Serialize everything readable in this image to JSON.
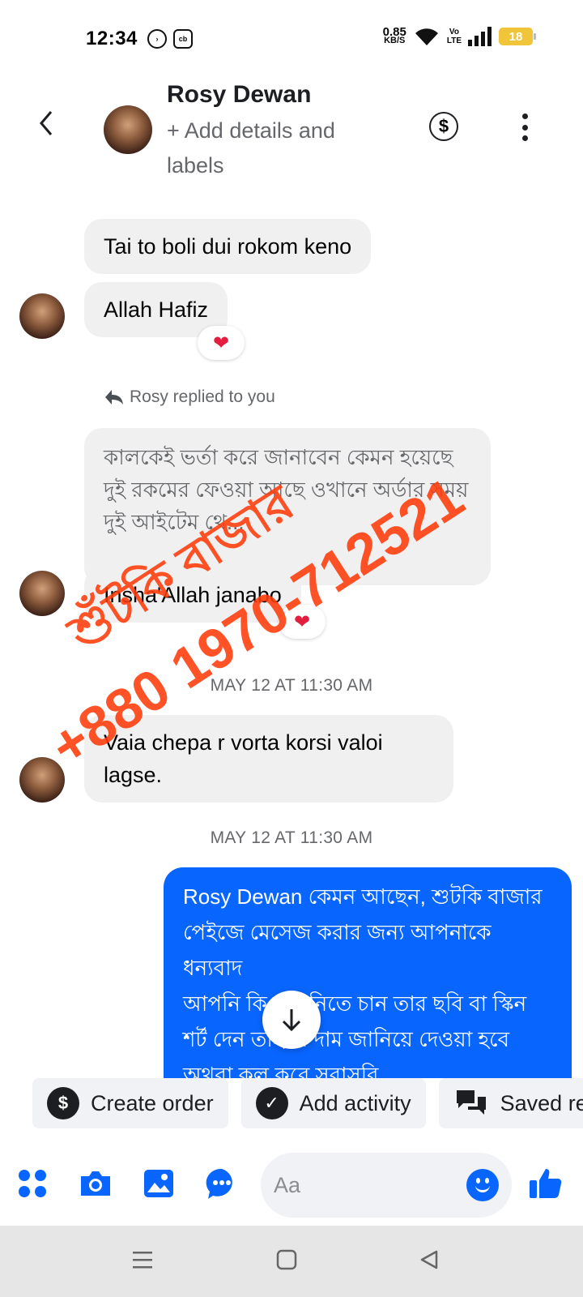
{
  "status_bar": {
    "time": "12:34",
    "speed_value": "0.85",
    "speed_unit": "KB/S",
    "volte_top": "Vo",
    "volte_bottom": "LTE",
    "battery": "18"
  },
  "header": {
    "contact_name": "Rosy Dewan",
    "add_details": "+ Add details and labels",
    "back_icon": "chevron-left-icon",
    "pay_icon": "dollar-circle-icon",
    "more_icon": "vertical-dots-icon"
  },
  "messages": {
    "m1": "Tai to boli dui rokom keno",
    "m2": "Allah Hafiz",
    "reply_label": "Rosy replied to you",
    "quoted": "কালকেই ভর্তা করে জানাবেন কেমন হয়েছে দুই রকমের ফেওয়া আছে ওখানে অর্ডার সময় দুই আইটেম থে...",
    "m3": "Insha'Allah janabo",
    "timestamp1": "MAY 12 AT 11:30 AM",
    "m4": "Vaia chepa r vorta korsi valoi lagse.",
    "timestamp2": "MAY 12 AT 11:30 AM",
    "outgoing": "Rosy Dewan কেমন আছেন, শুটকি বাজার পেইজে মেসেজ করার জন্য আপনাকে ধন্যবাদ\nআপনি কি ক্রয় নিতে চান তার ছবি বা স্কিন শর্ট দেন তাহলে দাম জানিয়ে দেওয়া হবে অথবা কল করে সরাসরি",
    "reaction": "❤"
  },
  "watermark": {
    "line1": "শুঁটকি বাজার",
    "line2": "+880 1970-712521"
  },
  "actions": {
    "create_order": "Create order",
    "add_activity": "Add activity",
    "saved_replies": "Saved replies"
  },
  "composer": {
    "placeholder": "Aa"
  },
  "colors": {
    "accent": "#0866ff",
    "watermark": "#ff3b0a",
    "reaction": "#e41e3f"
  }
}
